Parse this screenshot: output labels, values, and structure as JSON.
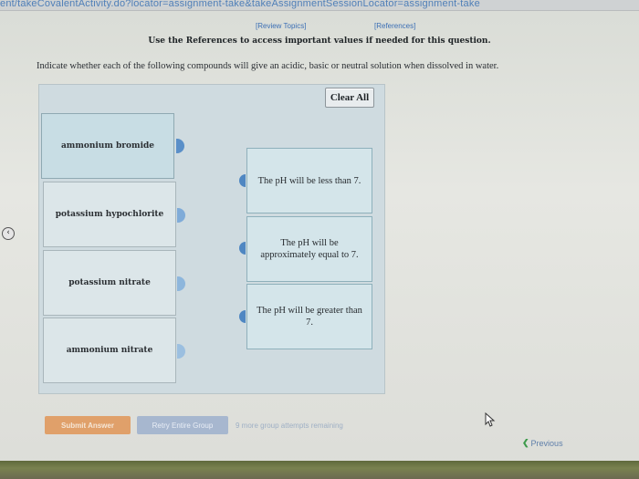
{
  "browser": {
    "url_fragment": "ent/takeCovalentActivity.do?locator=assignment-take&takeAssignmentSessionLocator=assignment-take"
  },
  "header": {
    "review_topics": "[Review Topics]",
    "references": "[References]",
    "instructions": "Use the References to access important values if needed for this question."
  },
  "question": {
    "prompt": "Indicate whether each of the following compounds will give an acidic, basic or neutral solution when dissolved in water."
  },
  "toolbar": {
    "clear_all": "Clear All"
  },
  "items": [
    {
      "label": "ammonium bromide"
    },
    {
      "label": "potassium hypochlorite"
    },
    {
      "label": "potassium nitrate"
    },
    {
      "label": "ammonium nitrate"
    }
  ],
  "targets": [
    {
      "label": "The pH will be less than 7."
    },
    {
      "label": "The pH will be approximately equal to 7."
    },
    {
      "label": "The pH will be greater than 7."
    }
  ],
  "footer": {
    "submit": "Submit Answer",
    "retry": "Retry Entire Group",
    "remaining": "9 more group attempts remaining",
    "previous": "Previous"
  },
  "colors": {
    "accent_blue": "#5a8fc8",
    "submit_orange": "#e0a06a",
    "retry_blue": "#a7b7cf",
    "panel_bg": "#cfdbe0"
  },
  "icons": {
    "side": "chevron-left-icon",
    "cursor": "mouse-cursor-icon",
    "previous": "chevron-left-icon"
  }
}
